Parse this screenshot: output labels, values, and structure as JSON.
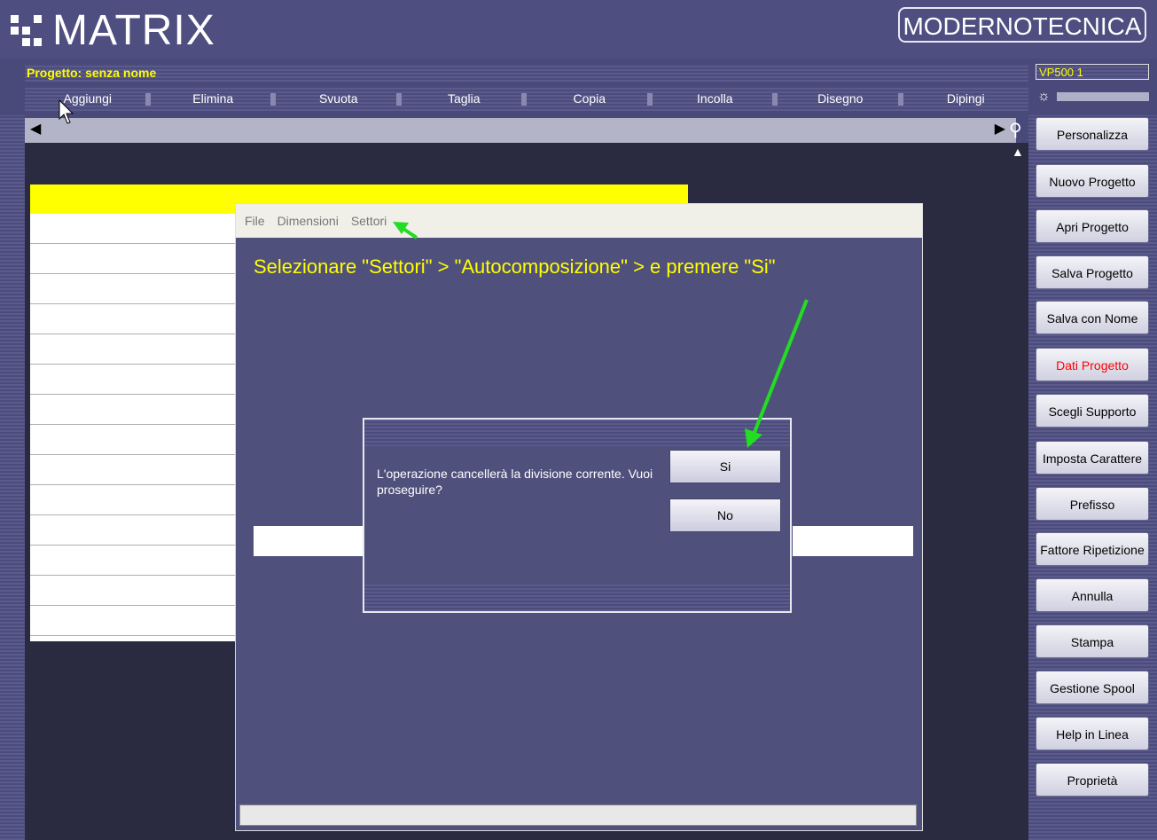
{
  "header": {
    "logo_text": "MATRIX",
    "brand": "MODERNOTECNICA"
  },
  "project": {
    "title": "Progetto: senza nome",
    "device": "VP500 1"
  },
  "menubar": {
    "items": [
      {
        "label": "Aggiungi"
      },
      {
        "label": "Elimina"
      },
      {
        "label": "Svuota"
      },
      {
        "label": "Taglia"
      },
      {
        "label": "Copia"
      },
      {
        "label": "Incolla"
      },
      {
        "label": "Disegno"
      },
      {
        "label": "Dipingi"
      }
    ]
  },
  "sidebar": {
    "buttons": [
      {
        "label": "Personalizza"
      },
      {
        "label": "Nuovo Progetto"
      },
      {
        "label": "Apri Progetto"
      },
      {
        "label": "Salva Progetto"
      },
      {
        "label": "Salva con Nome"
      },
      {
        "label": "Dati Progetto"
      },
      {
        "label": "Scegli Supporto"
      },
      {
        "label": "Imposta Carattere"
      },
      {
        "label": "Prefisso"
      },
      {
        "label": "Fattore Ripetizione"
      },
      {
        "label": "Annulla"
      },
      {
        "label": "Stampa"
      },
      {
        "label": "Gestione Spool"
      },
      {
        "label": "Help in Linea"
      },
      {
        "label": "Proprietà"
      }
    ]
  },
  "settori_window": {
    "menu": [
      {
        "label": "File"
      },
      {
        "label": "Dimensioni"
      },
      {
        "label": "Settori"
      }
    ],
    "instruction": "Selezionare \"Settori\" > \"Autocomposizione\" > e premere \"Si\""
  },
  "dialog": {
    "message": "L'operazione cancellerà la divisione corrente. Vuoi proseguire?",
    "yes_label": "Si",
    "no_label": "No"
  },
  "colors": {
    "accent_yellow": "#ffff00",
    "highlight_red": "#ff0000",
    "annotation_green": "#22dd22"
  }
}
